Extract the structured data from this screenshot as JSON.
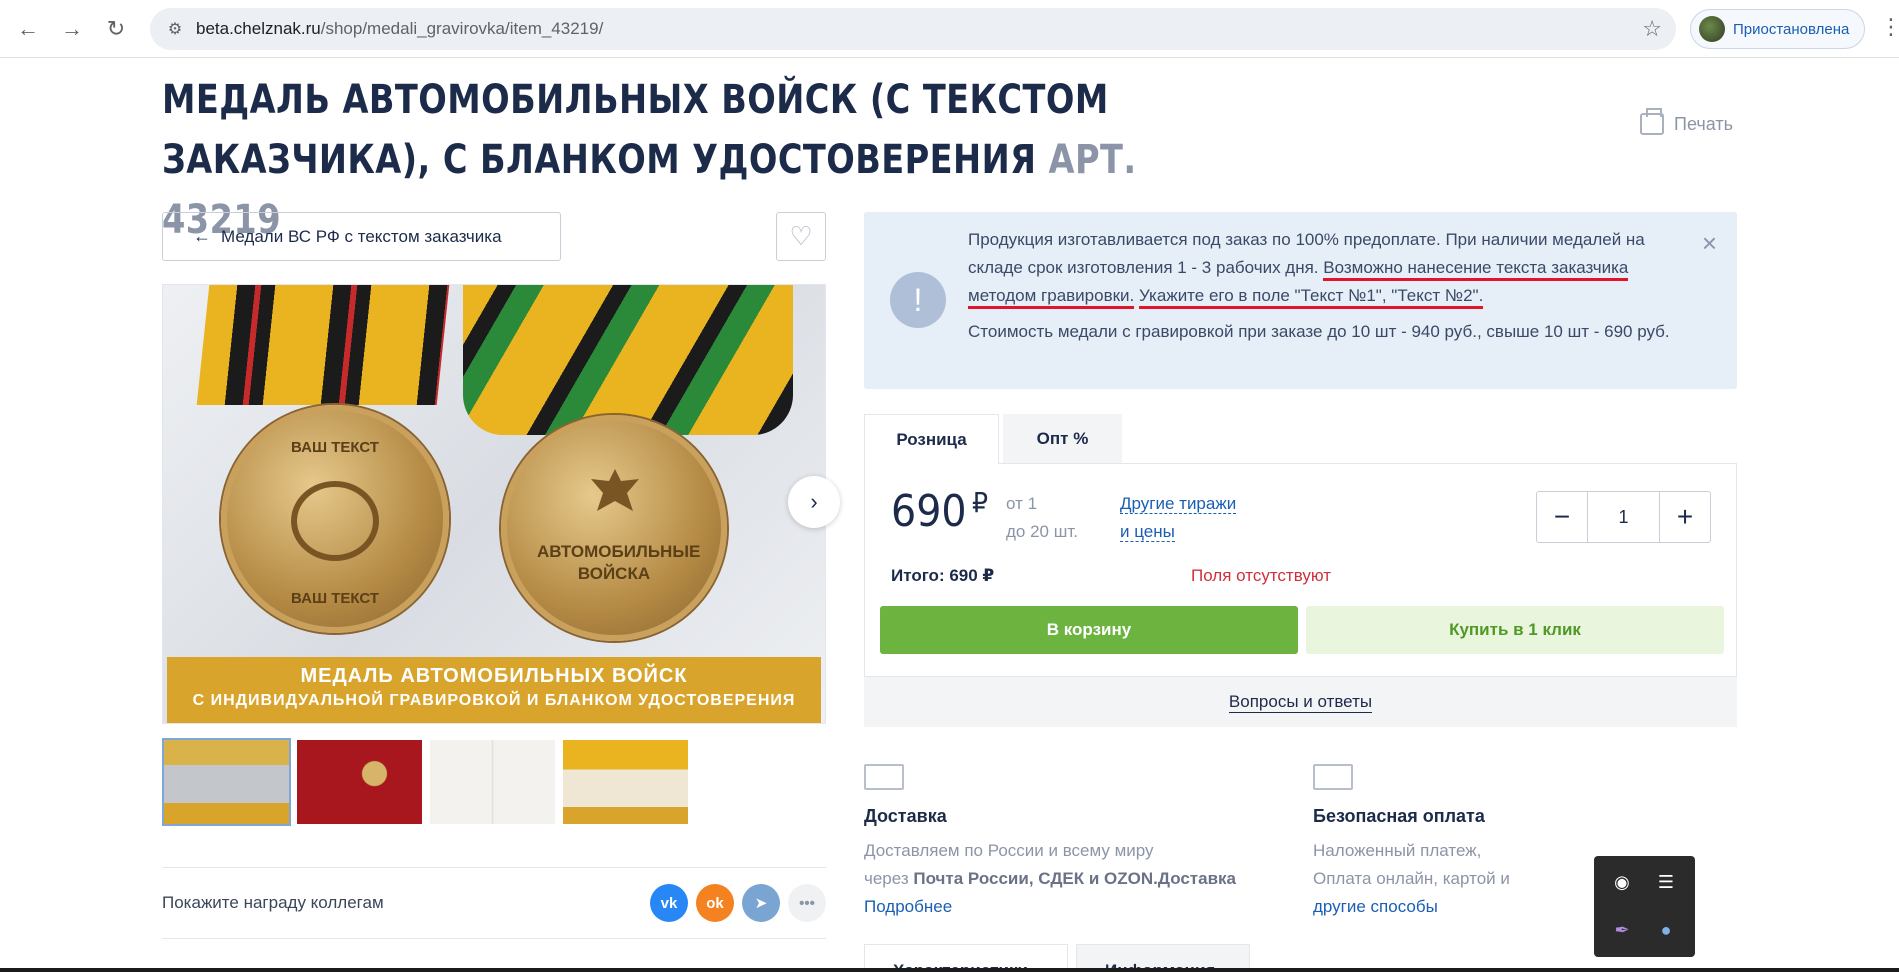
{
  "browser": {
    "url_host": "beta.chelznak.ru",
    "url_path": "/shop/medali_gravirovka/item_43219/",
    "profile_label": "Приостановлена",
    "back_icon": "arrow-left-icon",
    "forward_icon": "arrow-right-icon",
    "reload_icon": "reload-icon",
    "bookmark_icon": "star-icon"
  },
  "product": {
    "title": "МЕДАЛЬ АВТОМОБИЛЬНЫХ ВОЙСК (С ТЕКСТОМ ЗАКАЗЧИКА), С БЛАНКОМ УДОСТОВЕРЕНИЯ",
    "article": "АРТ. 43219",
    "print_label": "Печать",
    "back_category": "Медали ВС РФ с текстом заказчика",
    "image_banner_line1": "МЕДАЛЬ АВТОМОБИЛЬНЫХ ВОЙСК",
    "image_banner_line2": "С ИНДИВИДУАЛЬНОЙ ГРАВИРОВКОЙ И БЛАНКОМ УДОСТОВЕРЕНИЯ",
    "medal_text_top": "ВАШ ТЕКСТ",
    "medal_text_bottom": "ВАШ ТЕКСТ",
    "medal_reverse_text": "АВТОМОБИЛЬНЫЕ ВОЙСКА"
  },
  "share": {
    "label": "Покажите награду коллегам",
    "vk": "vk",
    "ok": "ok",
    "more": "•••"
  },
  "notice": {
    "text_plain": "Продукция изготавливается под заказ по 100% предоплате. При наличии медалей на складе срок изготовления 1 - 3 рабочих дня. ",
    "text_underlined_1": "Возможно нанесение текста заказчика методом гравировки.",
    "text_underlined_2": "Укажите его в поле \"Текст №1\", \"Текст №2\".",
    "text_cost": "Стоимость медали с гравировкой при заказе до 10 шт - 940 руб., свыше 10 шт - 690 руб.",
    "icon": "!",
    "close": "×"
  },
  "tabs": {
    "retail": "Розница",
    "wholesale": "Опт %"
  },
  "pricing": {
    "price": "690",
    "currency": "₽",
    "range_from": "от 1",
    "range_to": "до 20 шт.",
    "other_line1": "Другие тиражи",
    "other_line2": "и цены",
    "quantity": "1",
    "minus": "−",
    "plus": "+",
    "total": "Итого: 690 ₽",
    "fields_missing": "Поля отсутствуют",
    "cart_button": "В корзину",
    "one_click_button": "Купить в 1 клик",
    "qa_link": "Вопросы и ответы"
  },
  "delivery": {
    "title": "Доставка",
    "line1": "Доставляем по России и всему миру",
    "line2_prefix": "через ",
    "line2_bold": "Почта России, СДЕК и OZON.",
    "line2_tail": "Доставка",
    "link": "Подробнее"
  },
  "payment": {
    "title": "Безопасная оплата",
    "line1": "Наложенный платеж,",
    "line2": "Оплата онлайн, картой и",
    "line3": "другие способы"
  },
  "bottom_tabs": {
    "characteristics": "Характеристики",
    "information": "Информация"
  },
  "colors": {
    "accent_green": "#6db33f",
    "link_blue": "#1a5fb4",
    "warning_red": "#d0303c",
    "notice_bg": "#e6eef8",
    "banner_gold": "#d9a42c"
  }
}
